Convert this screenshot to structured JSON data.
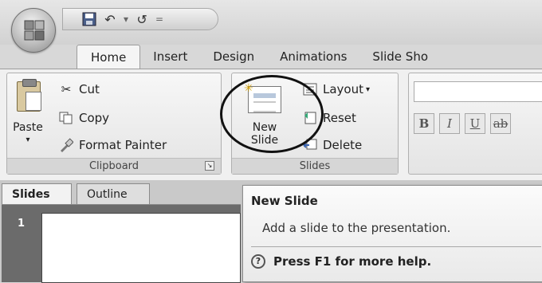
{
  "qat": {
    "save_icon": "save-icon",
    "undo_glyph": "↶",
    "dropdown_glyph": "▾",
    "redo_glyph": "↺",
    "customize_glyph": "="
  },
  "tabs": [
    {
      "label": "Home"
    },
    {
      "label": "Insert"
    },
    {
      "label": "Design"
    },
    {
      "label": "Animations"
    },
    {
      "label": "Slide Sho"
    }
  ],
  "clipboard": {
    "paste_label": "Paste",
    "paste_arrow": "▾",
    "cut_label": "Cut",
    "copy_label": "Copy",
    "format_painter_label": "Format Painter",
    "group_label": "Clipboard"
  },
  "slides_group": {
    "new_slide_label_1": "New",
    "new_slide_label_2": "Slide",
    "layout_label": "Layout",
    "reset_label": "Reset",
    "delete_label": "Delete",
    "group_label": "Slides"
  },
  "font_group": {
    "bold": "B",
    "italic": "I",
    "underline": "U",
    "strike": "ab"
  },
  "pane": {
    "slides_tab": "Slides",
    "outline_tab": "Outline",
    "slide_number": "1"
  },
  "tooltip": {
    "title": "New Slide",
    "description": "Add a slide to the presentation.",
    "help": "Press F1 for more help."
  }
}
